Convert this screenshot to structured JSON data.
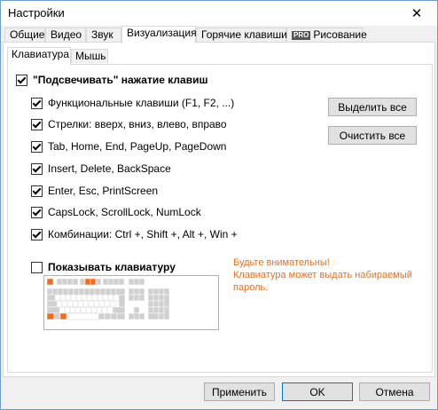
{
  "window": {
    "title": "Настройки",
    "close_glyph": "✕"
  },
  "main_tabs": [
    {
      "label": "Общие",
      "active": false
    },
    {
      "label": "Видео",
      "active": false
    },
    {
      "label": "Звук",
      "active": false
    },
    {
      "label": "Визуализация",
      "active": true
    },
    {
      "label": "Горячие клавиши",
      "active": false
    },
    {
      "label": "Рисование",
      "active": false,
      "badge": "PRO"
    }
  ],
  "sub_tabs": [
    {
      "label": "Клавиатура",
      "active": true
    },
    {
      "label": "Мышь",
      "active": false
    }
  ],
  "highlight": {
    "label": "\"Подсвечивать\" нажатие клавиш",
    "checked": true
  },
  "options": [
    {
      "label": "Функциональные клавиши (F1, F2, ...)",
      "checked": true
    },
    {
      "label": "Стрелки: вверх, вниз, влево, вправо",
      "checked": true
    },
    {
      "label": "Tab, Home, End, PageUp, PageDown",
      "checked": true
    },
    {
      "label": "Insert, Delete, BackSpace",
      "checked": true
    },
    {
      "label": "Enter, Esc, PrintScreen",
      "checked": true
    },
    {
      "label": "CapsLock, ScrollLock, NumLock",
      "checked": true
    },
    {
      "label": "Комбинации: Ctrl +, Shift +, Alt +, Win +",
      "checked": true
    }
  ],
  "side_buttons": {
    "select_all": "Выделить все",
    "clear_all": "Очистить все"
  },
  "show_keyboard": {
    "label": "Показывать клавиатуру",
    "checked": false
  },
  "warning": {
    "line1": "Будьте внимательны!",
    "line2": "Клавиатура может выдать набираемый",
    "line3": "пароль."
  },
  "bottom_buttons": {
    "apply": "Применить",
    "ok": "OK",
    "cancel": "Отмена"
  },
  "colors": {
    "accent": "#0078d7",
    "warning": "#f06c1e",
    "key_highlight": "#f06c1e",
    "key": "#d0d0d0"
  }
}
